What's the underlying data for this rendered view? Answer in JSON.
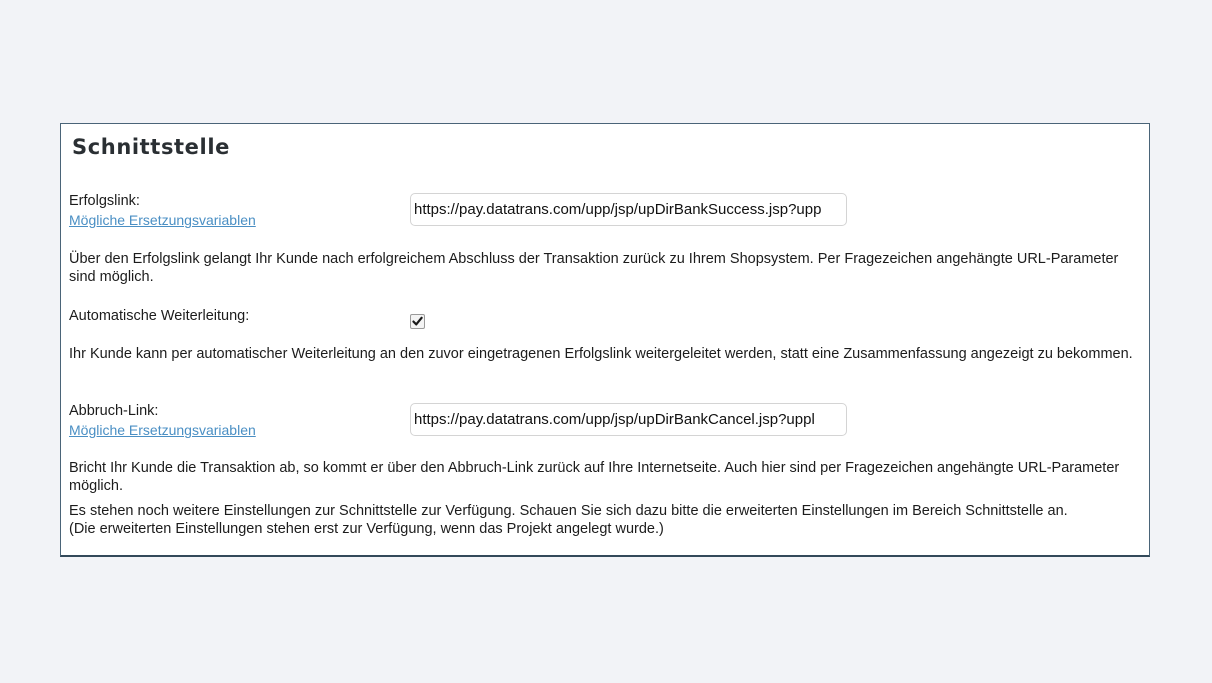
{
  "section": {
    "title": "Schnittstelle"
  },
  "success_link": {
    "label": "Erfolgslink:",
    "variables_link": "Mögliche Ersetzungsvariablen",
    "value": "https://pay.datatrans.com/upp/jsp/upDirBankSuccess.jsp?upp",
    "description": "Über den Erfolgslink gelangt Ihr Kunde nach erfolgreichem Abschluss der Transaktion zurück zu Ihrem Shopsystem. Per Fragezeichen angehängte URL-Parameter sind möglich."
  },
  "auto_redirect": {
    "label": "Automatische Weiterleitung:",
    "checked": true,
    "description": "Ihr Kunde kann per automatischer Weiterleitung an den zuvor eingetragenen Erfolgslink weitergeleitet werden, statt eine Zusammenfassung angezeigt zu bekommen."
  },
  "cancel_link": {
    "label": "Abbruch-Link:",
    "variables_link": "Mögliche Ersetzungsvariablen",
    "value": "https://pay.datatrans.com/upp/jsp/upDirBankCancel.jsp?uppl",
    "description": "Bricht Ihr Kunde die Transaktion ab, so kommt er über den Abbruch-Link zurück auf Ihre Internetseite. Auch hier sind per Fragezeichen angehängte URL-Parameter möglich."
  },
  "footer_note": {
    "line1": "Es stehen noch weitere Einstellungen zur Schnittstelle zur Verfügung. Schauen Sie sich dazu bitte die erweiterten Einstellungen im Bereich Schnittstelle an.",
    "line2": "(Die erweiterten Einstellungen stehen erst zur Verfügung, wenn das Projekt angelegt wurde.)"
  }
}
